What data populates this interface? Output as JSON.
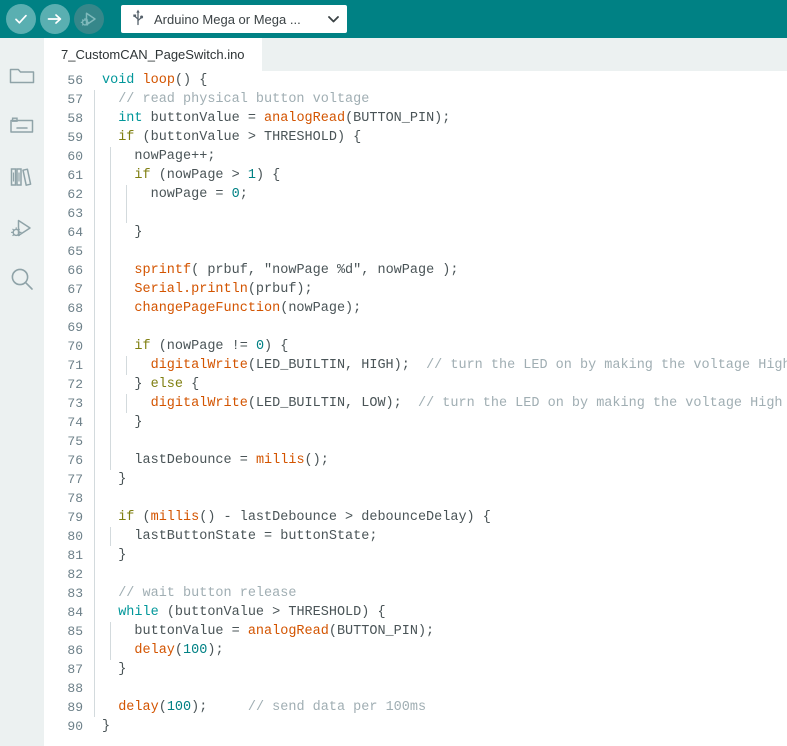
{
  "toolbar": {
    "verify_label": "Verify",
    "upload_label": "Upload",
    "debug_label": "Debug",
    "verify_icon": "check-circle-icon",
    "upload_icon": "arrow-right-circle-icon",
    "debug_icon": "debug-play-icon",
    "usb_icon": "usb-icon",
    "chevron_icon": "chevron-down-icon",
    "board_label": "Arduino Mega or Mega ...",
    "background": "#008184",
    "button_color": "#5aafb1",
    "button_disabled_color": "#36878a"
  },
  "sidebar": {
    "background": "#ecf1f1",
    "items": [
      {
        "name": "sketchbook",
        "icon": "folder-icon"
      },
      {
        "name": "boards-manager",
        "icon": "board-chip-icon"
      },
      {
        "name": "library-manager",
        "icon": "books-icon"
      },
      {
        "name": "debug",
        "icon": "debug-play-icon"
      },
      {
        "name": "search",
        "icon": "search-icon"
      }
    ]
  },
  "tabbar": {
    "active_tab": "7_CustomCAN_PageSwitch.ino",
    "background": "#ecf1f1",
    "active_background": "#ffffff"
  },
  "editor": {
    "first_line": 56,
    "last_line": 90,
    "line_number_color": "#6d8089",
    "text_color": "#4a5457",
    "comment_color": "#a0aeb3",
    "keyword_color": "#01979a",
    "control_color": "#7f7f11",
    "function_color": "#d35400",
    "indent_guide_color": "#d3dadd",
    "lines": [
      {
        "n": 56,
        "indent": 0,
        "tokens": [
          {
            "c": "t-key",
            "t": "void"
          },
          {
            "c": "t-plain",
            "t": " "
          },
          {
            "c": "t-fn",
            "t": "loop"
          },
          {
            "c": "t-plain",
            "t": "() {"
          }
        ]
      },
      {
        "n": 57,
        "indent": 1,
        "tokens": [
          {
            "c": "t-plain",
            "t": "  "
          },
          {
            "c": "t-cmt",
            "t": "// read physical button voltage"
          }
        ]
      },
      {
        "n": 58,
        "indent": 1,
        "tokens": [
          {
            "c": "t-plain",
            "t": "  "
          },
          {
            "c": "t-key",
            "t": "int"
          },
          {
            "c": "t-plain",
            "t": " buttonValue = "
          },
          {
            "c": "t-fn",
            "t": "analogRead"
          },
          {
            "c": "t-plain",
            "t": "(BUTTON_PIN);"
          }
        ]
      },
      {
        "n": 59,
        "indent": 1,
        "tokens": [
          {
            "c": "t-plain",
            "t": "  "
          },
          {
            "c": "t-ctl",
            "t": "if"
          },
          {
            "c": "t-plain",
            "t": " (buttonValue > THRESHOLD) {"
          }
        ]
      },
      {
        "n": 60,
        "indent": 2,
        "tokens": [
          {
            "c": "t-plain",
            "t": "    nowPage++;"
          }
        ]
      },
      {
        "n": 61,
        "indent": 2,
        "tokens": [
          {
            "c": "t-plain",
            "t": "    "
          },
          {
            "c": "t-ctl",
            "t": "if"
          },
          {
            "c": "t-plain",
            "t": " (nowPage > "
          },
          {
            "c": "t-num",
            "t": "1"
          },
          {
            "c": "t-plain",
            "t": ") {"
          }
        ]
      },
      {
        "n": 62,
        "indent": 3,
        "tokens": [
          {
            "c": "t-plain",
            "t": "      nowPage = "
          },
          {
            "c": "t-num",
            "t": "0"
          },
          {
            "c": "t-plain",
            "t": ";"
          }
        ]
      },
      {
        "n": 63,
        "indent": 3,
        "tokens": []
      },
      {
        "n": 64,
        "indent": 2,
        "tokens": [
          {
            "c": "t-plain",
            "t": "    }"
          }
        ]
      },
      {
        "n": 65,
        "indent": 2,
        "tokens": []
      },
      {
        "n": 66,
        "indent": 2,
        "tokens": [
          {
            "c": "t-plain",
            "t": "    "
          },
          {
            "c": "t-fn",
            "t": "sprintf"
          },
          {
            "c": "t-plain",
            "t": "( prbuf, "
          },
          {
            "c": "t-str",
            "t": "\"nowPage %d\""
          },
          {
            "c": "t-plain",
            "t": ", nowPage );"
          }
        ]
      },
      {
        "n": 67,
        "indent": 2,
        "tokens": [
          {
            "c": "t-plain",
            "t": "    "
          },
          {
            "c": "t-fn",
            "t": "Serial.println"
          },
          {
            "c": "t-plain",
            "t": "(prbuf);"
          }
        ]
      },
      {
        "n": 68,
        "indent": 2,
        "tokens": [
          {
            "c": "t-plain",
            "t": "    "
          },
          {
            "c": "t-fn",
            "t": "changePageFunction"
          },
          {
            "c": "t-plain",
            "t": "(nowPage);"
          }
        ]
      },
      {
        "n": 69,
        "indent": 2,
        "tokens": []
      },
      {
        "n": 70,
        "indent": 2,
        "tokens": [
          {
            "c": "t-plain",
            "t": "    "
          },
          {
            "c": "t-ctl",
            "t": "if"
          },
          {
            "c": "t-plain",
            "t": " (nowPage != "
          },
          {
            "c": "t-num",
            "t": "0"
          },
          {
            "c": "t-plain",
            "t": ") {"
          }
        ]
      },
      {
        "n": 71,
        "indent": 3,
        "tokens": [
          {
            "c": "t-plain",
            "t": "      "
          },
          {
            "c": "t-fn",
            "t": "digitalWrite"
          },
          {
            "c": "t-plain",
            "t": "(LED_BUILTIN, HIGH);  "
          },
          {
            "c": "t-cmt",
            "t": "// turn the LED on by making the voltage High"
          }
        ]
      },
      {
        "n": 72,
        "indent": 2,
        "tokens": [
          {
            "c": "t-plain",
            "t": "    } "
          },
          {
            "c": "t-ctl",
            "t": "else"
          },
          {
            "c": "t-plain",
            "t": " {"
          }
        ]
      },
      {
        "n": 73,
        "indent": 3,
        "tokens": [
          {
            "c": "t-plain",
            "t": "      "
          },
          {
            "c": "t-fn",
            "t": "digitalWrite"
          },
          {
            "c": "t-plain",
            "t": "(LED_BUILTIN, LOW);  "
          },
          {
            "c": "t-cmt",
            "t": "// turn the LED on by making the voltage High"
          }
        ]
      },
      {
        "n": 74,
        "indent": 2,
        "tokens": [
          {
            "c": "t-plain",
            "t": "    }"
          }
        ]
      },
      {
        "n": 75,
        "indent": 2,
        "tokens": []
      },
      {
        "n": 76,
        "indent": 2,
        "tokens": [
          {
            "c": "t-plain",
            "t": "    lastDebounce = "
          },
          {
            "c": "t-fn",
            "t": "millis"
          },
          {
            "c": "t-plain",
            "t": "();"
          }
        ]
      },
      {
        "n": 77,
        "indent": 1,
        "tokens": [
          {
            "c": "t-plain",
            "t": "  }"
          }
        ]
      },
      {
        "n": 78,
        "indent": 1,
        "tokens": []
      },
      {
        "n": 79,
        "indent": 1,
        "tokens": [
          {
            "c": "t-plain",
            "t": "  "
          },
          {
            "c": "t-ctl",
            "t": "if"
          },
          {
            "c": "t-plain",
            "t": " ("
          },
          {
            "c": "t-fn",
            "t": "millis"
          },
          {
            "c": "t-plain",
            "t": "() - lastDebounce > debounceDelay) {"
          }
        ]
      },
      {
        "n": 80,
        "indent": 2,
        "tokens": [
          {
            "c": "t-plain",
            "t": "    lastButtonState = buttonState;"
          }
        ]
      },
      {
        "n": 81,
        "indent": 1,
        "tokens": [
          {
            "c": "t-plain",
            "t": "  }"
          }
        ]
      },
      {
        "n": 82,
        "indent": 1,
        "tokens": []
      },
      {
        "n": 83,
        "indent": 1,
        "tokens": [
          {
            "c": "t-plain",
            "t": "  "
          },
          {
            "c": "t-cmt",
            "t": "// wait button release"
          }
        ]
      },
      {
        "n": 84,
        "indent": 1,
        "tokens": [
          {
            "c": "t-plain",
            "t": "  "
          },
          {
            "c": "t-key",
            "t": "while"
          },
          {
            "c": "t-plain",
            "t": " (buttonValue > THRESHOLD) {"
          }
        ]
      },
      {
        "n": 85,
        "indent": 2,
        "tokens": [
          {
            "c": "t-plain",
            "t": "    buttonValue = "
          },
          {
            "c": "t-fn",
            "t": "analogRead"
          },
          {
            "c": "t-plain",
            "t": "(BUTTON_PIN);"
          }
        ]
      },
      {
        "n": 86,
        "indent": 2,
        "tokens": [
          {
            "c": "t-plain",
            "t": "    "
          },
          {
            "c": "t-fn",
            "t": "delay"
          },
          {
            "c": "t-plain",
            "t": "("
          },
          {
            "c": "t-num",
            "t": "100"
          },
          {
            "c": "t-plain",
            "t": ");"
          }
        ]
      },
      {
        "n": 87,
        "indent": 1,
        "tokens": [
          {
            "c": "t-plain",
            "t": "  }"
          }
        ]
      },
      {
        "n": 88,
        "indent": 1,
        "tokens": []
      },
      {
        "n": 89,
        "indent": 1,
        "tokens": [
          {
            "c": "t-plain",
            "t": "  "
          },
          {
            "c": "t-fn",
            "t": "delay"
          },
          {
            "c": "t-plain",
            "t": "("
          },
          {
            "c": "t-num",
            "t": "100"
          },
          {
            "c": "t-plain",
            "t": ");     "
          },
          {
            "c": "t-cmt",
            "t": "// send data per 100ms"
          }
        ]
      },
      {
        "n": 90,
        "indent": 0,
        "tokens": [
          {
            "c": "t-plain",
            "t": "}"
          }
        ]
      }
    ]
  }
}
